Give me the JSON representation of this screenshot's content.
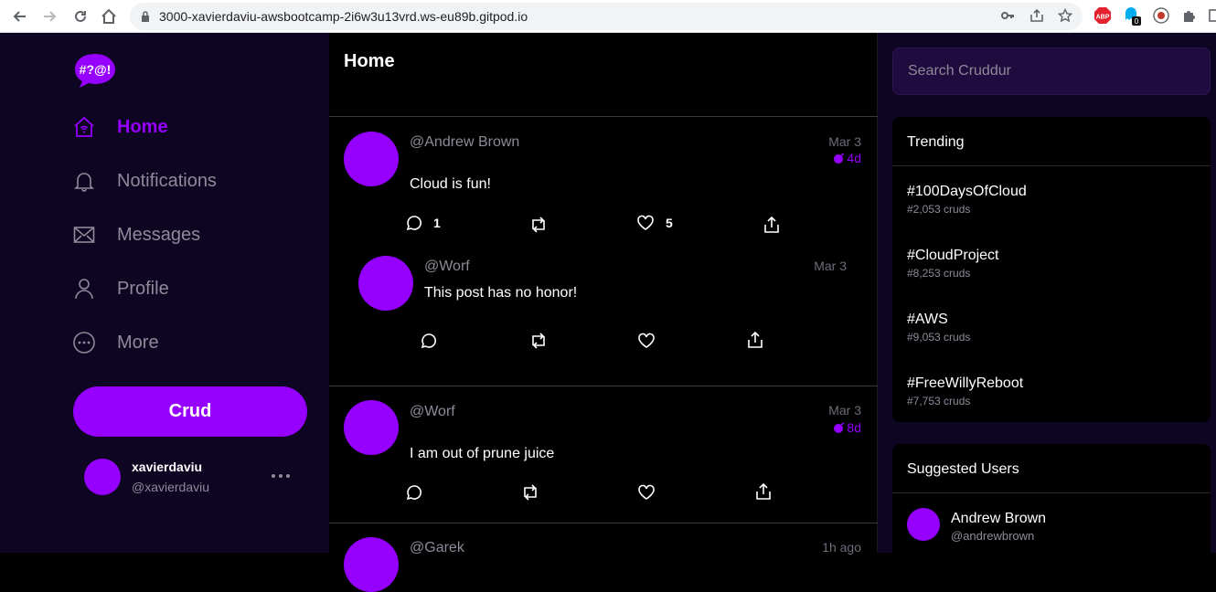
{
  "browser": {
    "url": "3000-xavierdaviu-awsbootcamp-2i6w3u13vrd.ws-eu89b.gitpod.io",
    "extensions": [
      "key-icon",
      "share-icon",
      "star-icon",
      "abp-icon",
      "ghostery-icon",
      "wordpress-icon",
      "puzzle-icon",
      "sidepanel-icon"
    ],
    "abp_label": "ABP",
    "ghostery_badge": "0"
  },
  "sidebar": {
    "logo_text": "#?@!",
    "menu": [
      {
        "label": "Home",
        "icon": "home-icon",
        "active": true
      },
      {
        "label": "Notifications",
        "icon": "bell-icon",
        "active": false
      },
      {
        "label": "Messages",
        "icon": "mail-icon",
        "active": false
      },
      {
        "label": "Profile",
        "icon": "user-icon",
        "active": false
      },
      {
        "label": "More",
        "icon": "more-circle-icon",
        "active": false
      }
    ],
    "crud_button": "Crud",
    "profile": {
      "name": "xavierdaviu",
      "handle": "@xavierdaviu"
    }
  },
  "feed": {
    "title": "Home",
    "activities": [
      {
        "handle": "@Andrew Brown",
        "date": "Mar 3",
        "expires": "4d",
        "message": "Cloud is fun!",
        "replies": "1",
        "reposts": "",
        "likes": "5",
        "reply": {
          "handle": "@Worf",
          "date": "Mar 3",
          "message": "This post has no honor!"
        }
      },
      {
        "handle": "@Worf",
        "date": "Mar 3",
        "expires": "8d",
        "message": "I am out of prune juice",
        "replies": "",
        "reposts": "",
        "likes": ""
      },
      {
        "handle": "@Garek",
        "date": "1h ago"
      }
    ]
  },
  "right": {
    "search_placeholder": "Search Cruddur",
    "trending": {
      "title": "Trending",
      "items": [
        {
          "tag": "#100DaysOfCloud",
          "count": "#2,053 cruds"
        },
        {
          "tag": "#CloudProject",
          "count": "#8,253 cruds"
        },
        {
          "tag": "#AWS",
          "count": "#9,053 cruds"
        },
        {
          "tag": "#FreeWillyReboot",
          "count": "#7,753 cruds"
        }
      ]
    },
    "suggested": {
      "title": "Suggested Users",
      "users": [
        {
          "name": "Andrew Brown",
          "handle": "@andrewbrown"
        }
      ]
    }
  },
  "colors": {
    "accent": "#9500ff",
    "sidebar_bg": "#0d0522",
    "feed_bg": "#000000"
  }
}
